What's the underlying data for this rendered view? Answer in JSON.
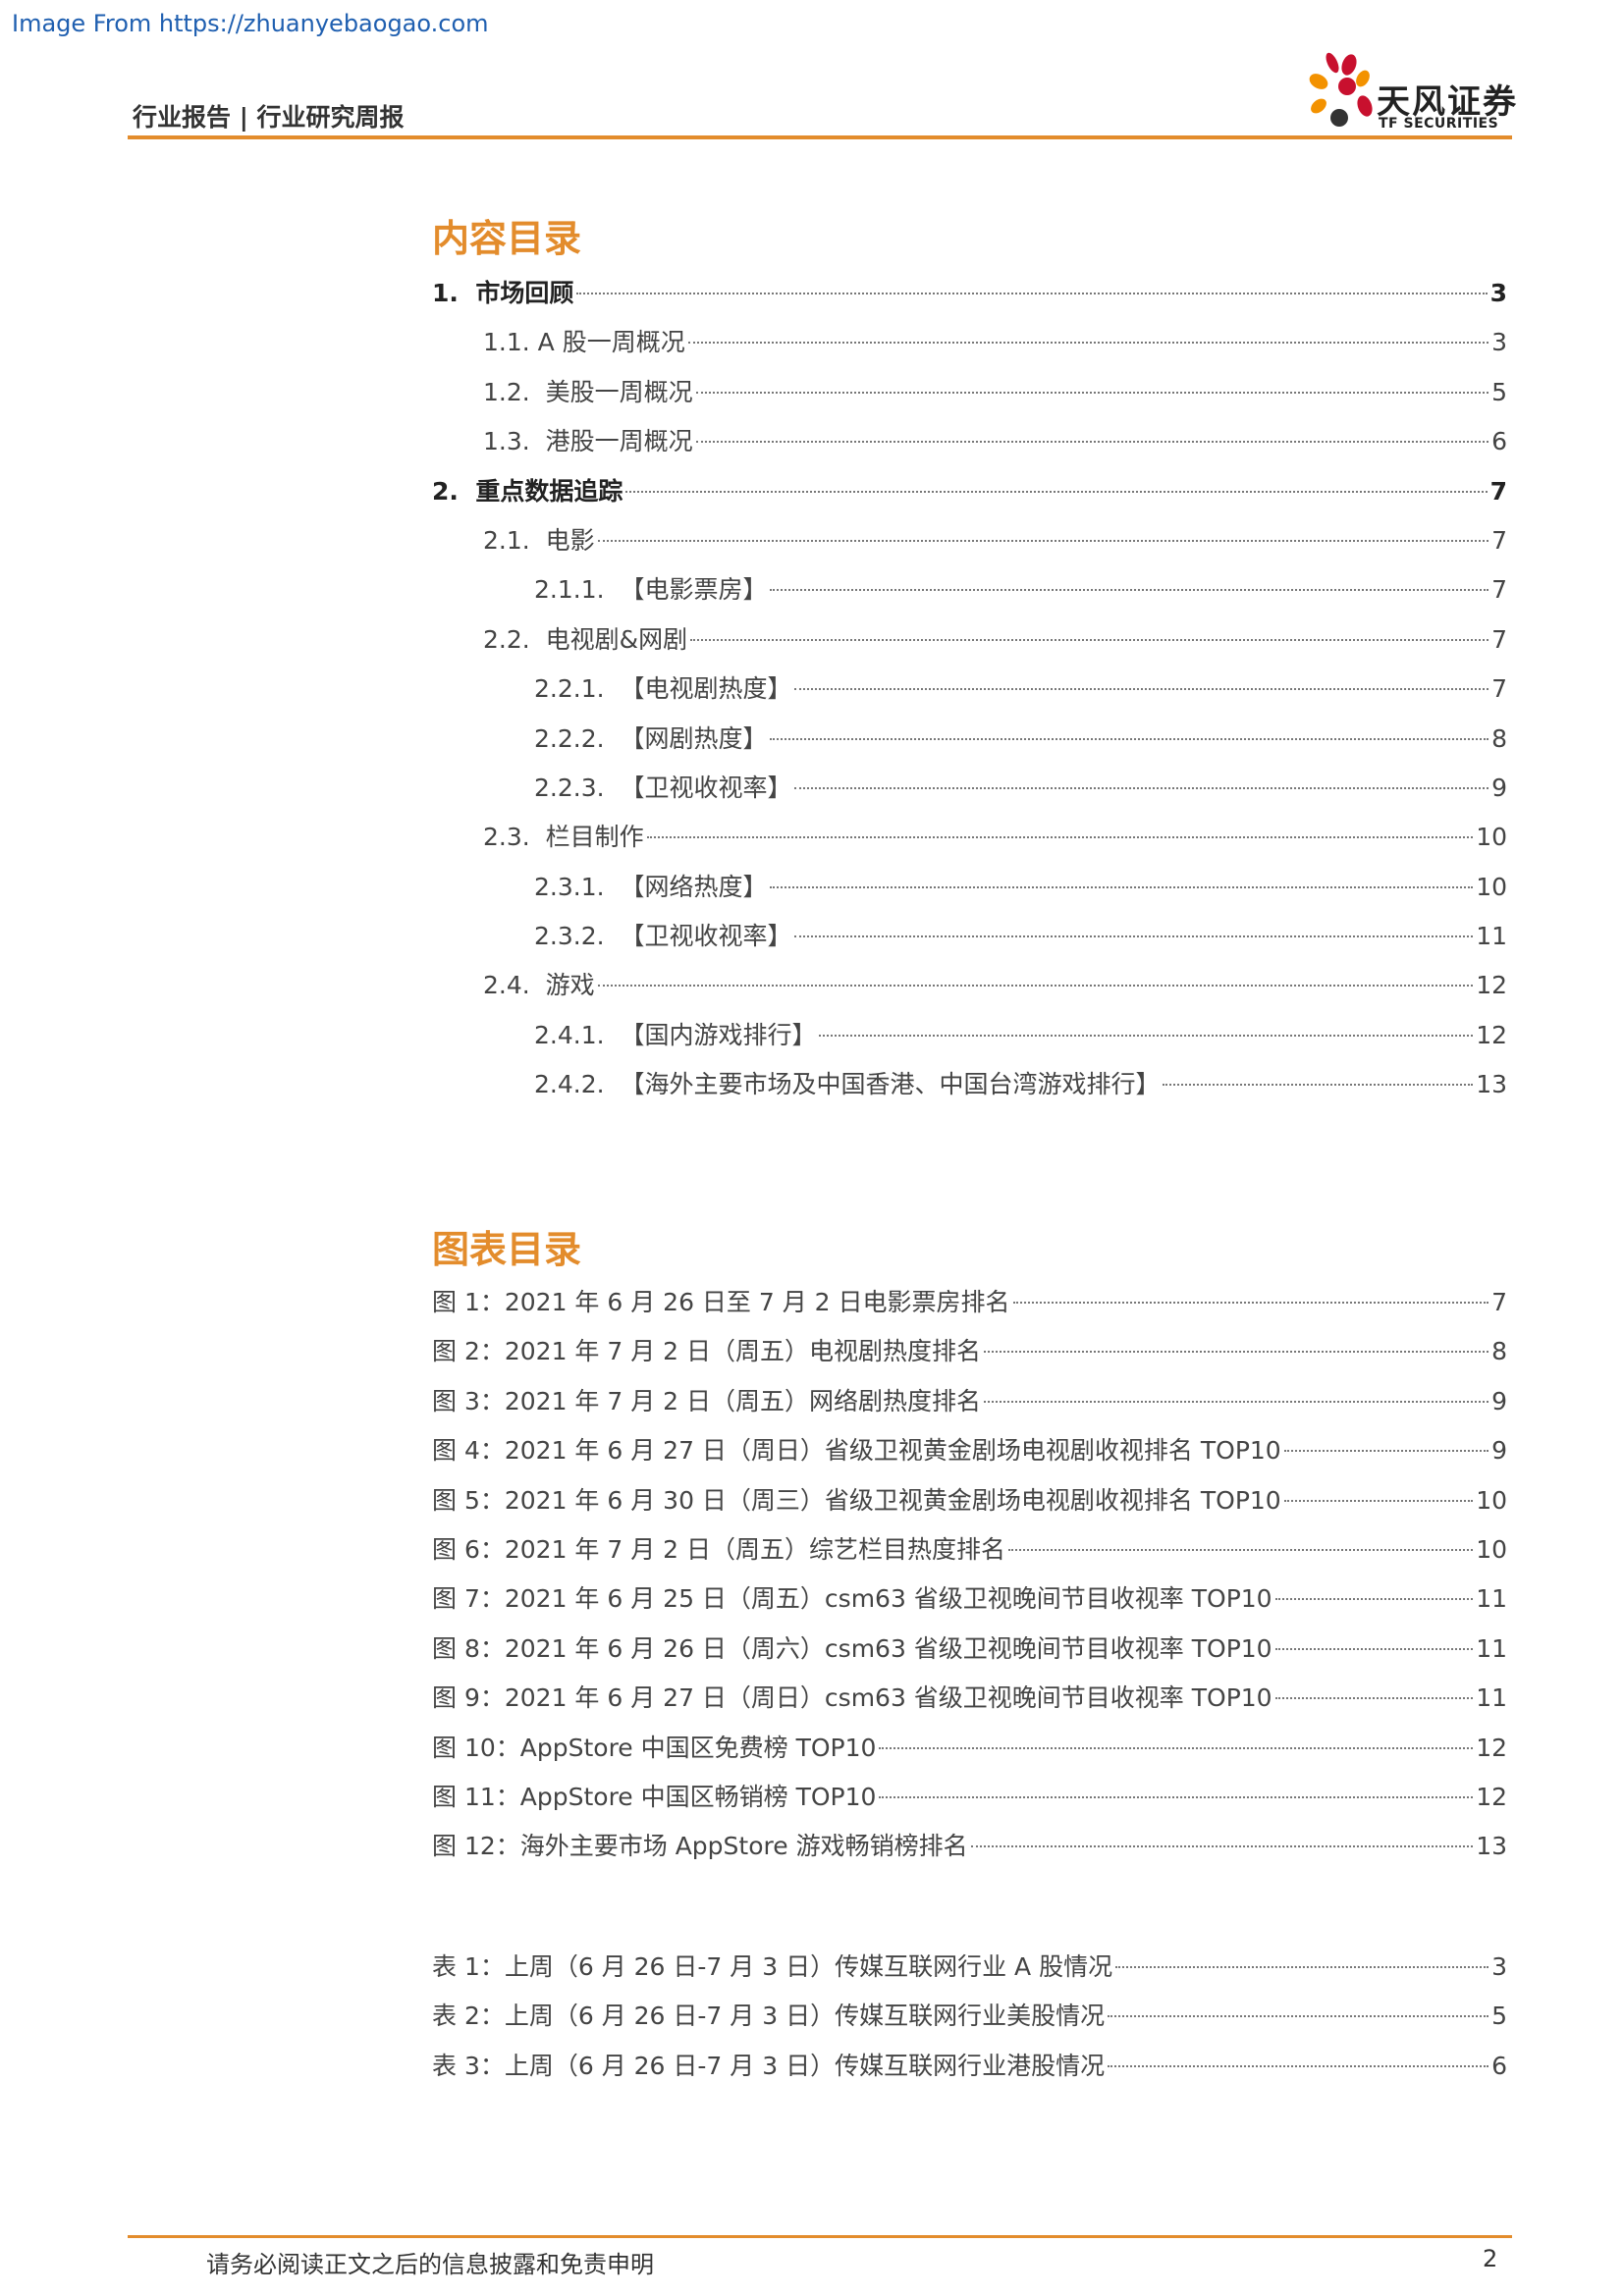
{
  "watermark": "Image From https://zhuanyebaogao.com",
  "header": {
    "title": "行业报告 | 行业研究周报",
    "logo_cn": "天风证券",
    "logo_en": "TF SECURITIES"
  },
  "contents": {
    "title": "内容目录",
    "items": [
      {
        "num": "1.  ",
        "label": "市场回顾",
        "page": "3",
        "level": 1
      },
      {
        "num": "1.1. ",
        "label": "A 股一周概况",
        "page": "3",
        "level": 2
      },
      {
        "num": "1.2.  ",
        "label": "美股一周概况",
        "page": "5",
        "level": 2
      },
      {
        "num": "1.3.  ",
        "label": "港股一周概况",
        "page": "6",
        "level": 2
      },
      {
        "num": "2.  ",
        "label": "重点数据追踪",
        "page": "7",
        "level": 1
      },
      {
        "num": "2.1.  ",
        "label": "电影",
        "page": "7",
        "level": 2
      },
      {
        "num": "2.1.1.  ",
        "label": "【电影票房】",
        "page": "7",
        "level": 3
      },
      {
        "num": "2.2.  ",
        "label": "电视剧&网剧",
        "page": "7",
        "level": 2
      },
      {
        "num": "2.2.1.  ",
        "label": "【电视剧热度】",
        "page": "7",
        "level": 3
      },
      {
        "num": "2.2.2.  ",
        "label": "【网剧热度】",
        "page": "8",
        "level": 3
      },
      {
        "num": "2.2.3.  ",
        "label": "【卫视收视率】",
        "page": "9",
        "level": 3
      },
      {
        "num": "2.3.  ",
        "label": "栏目制作",
        "page": "10",
        "level": 2
      },
      {
        "num": "2.3.1.  ",
        "label": "【网络热度】",
        "page": "10",
        "level": 3
      },
      {
        "num": "2.3.2.  ",
        "label": "【卫视收视率】",
        "page": "11",
        "level": 3
      },
      {
        "num": "2.4.  ",
        "label": "游戏",
        "page": "12",
        "level": 2
      },
      {
        "num": "2.4.1.  ",
        "label": "【国内游戏排行】",
        "page": "12",
        "level": 3
      },
      {
        "num": "2.4.2.  ",
        "label": "【海外主要市场及中国香港、中国台湾游戏排行】",
        "page": "13",
        "level": 3
      }
    ]
  },
  "figures": {
    "title": "图表目录",
    "items": [
      {
        "label": "图 1：2021 年 6 月 26 日至 7 月 2 日电影票房排名",
        "page": "7"
      },
      {
        "label": "图 2：2021 年 7 月 2 日（周五）电视剧热度排名",
        "page": "8"
      },
      {
        "label": "图 3：2021 年 7 月 2 日（周五）网络剧热度排名",
        "page": "9"
      },
      {
        "label": "图 4：2021 年 6 月 27 日（周日）省级卫视黄金剧场电视剧收视排名 TOP10",
        "page": "9"
      },
      {
        "label": "图 5：2021 年 6 月 30 日（周三）省级卫视黄金剧场电视剧收视排名 TOP10",
        "page": "10"
      },
      {
        "label": "图 6：2021 年 7 月 2 日（周五）综艺栏目热度排名",
        "page": "10"
      },
      {
        "label": "图 7：2021 年 6 月 25 日（周五）csm63 省级卫视晚间节目收视率 TOP10",
        "page": "11"
      },
      {
        "label": "图 8：2021 年 6 月 26 日（周六）csm63 省级卫视晚间节目收视率 TOP10",
        "page": "11"
      },
      {
        "label": "图 9：2021 年 6 月 27 日（周日）csm63 省级卫视晚间节目收视率 TOP10",
        "page": "11"
      },
      {
        "label": "图 10：AppStore 中国区免费榜 TOP10",
        "page": "12"
      },
      {
        "label": "图 11：AppStore 中国区畅销榜 TOP10",
        "page": "12"
      },
      {
        "label": "图 12：海外主要市场 AppStore 游戏畅销榜排名",
        "page": "13"
      }
    ]
  },
  "tables": {
    "items": [
      {
        "label": "表 1：上周（6 月 26 日-7 月 3 日）传媒互联网行业 A 股情况",
        "page": "3"
      },
      {
        "label": "表 2：上周（6 月 26 日-7 月 3 日）传媒互联网行业美股情况",
        "page": "5"
      },
      {
        "label": "表 3：上周（6 月 26 日-7 月 3 日）传媒互联网行业港股情况",
        "page": "6"
      }
    ]
  },
  "footer": {
    "disclaimer": "请务必阅读正文之后的信息披露和免责申明",
    "page_number": "2"
  },
  "colors": {
    "accent": "#e38c2c",
    "logo_red": "#c8102e",
    "logo_orange": "#f39200",
    "logo_dark": "#333333"
  }
}
